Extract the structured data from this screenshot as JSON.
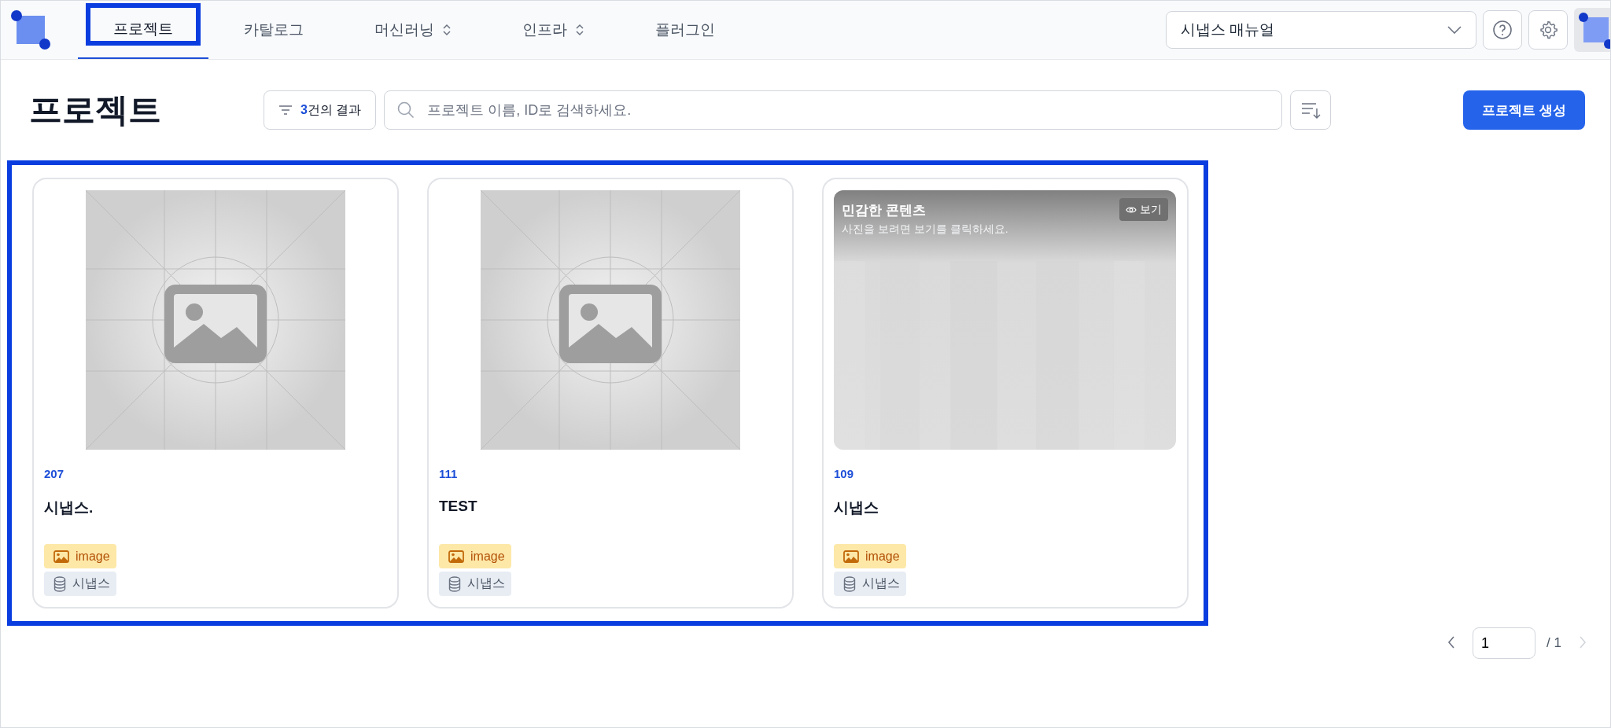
{
  "nav": {
    "tabs": [
      {
        "label": "프로젝트",
        "selected": true,
        "kind": "link"
      },
      {
        "label": "카탈로그",
        "selected": false,
        "kind": "link"
      },
      {
        "label": "머신러닝",
        "selected": false,
        "kind": "dropdown"
      },
      {
        "label": "인프라",
        "selected": false,
        "kind": "dropdown"
      },
      {
        "label": "플러그인",
        "selected": false,
        "kind": "link"
      }
    ],
    "manual_select": {
      "value": "시냅스 매뉴얼"
    }
  },
  "page": {
    "title": "프로젝트",
    "result_count": "3",
    "result_suffix": "건의 결과",
    "search": {
      "placeholder": "프로젝트 이름, ID로 검색하세요."
    },
    "create_button": "프로젝트 생성"
  },
  "projects": [
    {
      "id": "207",
      "name": "시냅스.",
      "kind": "placeholder",
      "tags": [
        {
          "kind": "type",
          "label": "image"
        },
        {
          "kind": "dataset",
          "label": "시냅스"
        }
      ]
    },
    {
      "id": "111",
      "name": "TEST",
      "kind": "placeholder",
      "tags": [
        {
          "kind": "type",
          "label": "image"
        },
        {
          "kind": "dataset",
          "label": "시냅스"
        }
      ]
    },
    {
      "id": "109",
      "name": "시냅스",
      "kind": "sensitive",
      "sensitive": {
        "title": "민감한 콘텐츠",
        "hint": "사진을 보려면 보기를 클릭하세요.",
        "button": "보기"
      },
      "tags": [
        {
          "kind": "type",
          "label": "image"
        },
        {
          "kind": "dataset",
          "label": "시냅스"
        }
      ]
    }
  ],
  "pagination": {
    "page": "1",
    "total": "/ 1"
  }
}
